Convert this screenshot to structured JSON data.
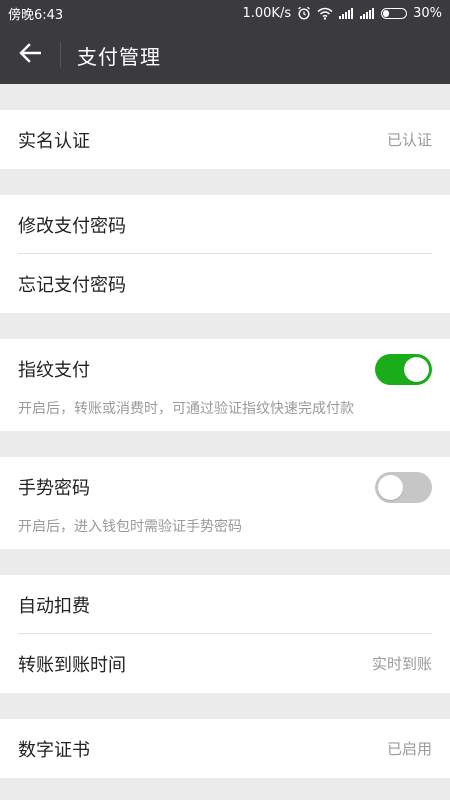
{
  "status_bar": {
    "time": "傍晚6:43",
    "speed": "1.00K/s",
    "battery_percent": "30%",
    "battery_level": 0.3,
    "icons": [
      "alarm-icon",
      "wifi-icon",
      "signal-icon",
      "signal-icon",
      "battery-icon"
    ]
  },
  "header": {
    "title": "支付管理",
    "back_icon": "arrow-left-icon"
  },
  "sections": {
    "verification": {
      "label": "实名认证",
      "value": "已认证"
    },
    "password": {
      "change_label": "修改支付密码",
      "forgot_label": "忘记支付密码"
    },
    "fingerprint": {
      "label": "指纹支付",
      "description": "开启后，转账或消费时，可通过验证指纹快速完成付款",
      "enabled": true
    },
    "gesture": {
      "label": "手势密码",
      "description": "开启后，进入钱包时需验证手势密码",
      "enabled": false
    },
    "deduction": {
      "auto_label": "自动扣费",
      "transfer_label": "转账到账时间",
      "transfer_value": "实时到账"
    },
    "certificate": {
      "label": "数字证书",
      "value": "已启用"
    }
  },
  "colors": {
    "bar_background": "#3b3a3f",
    "switch_on": "#1aad19",
    "switch_off": "#c6c6c6",
    "page_background": "#ebebeb"
  }
}
